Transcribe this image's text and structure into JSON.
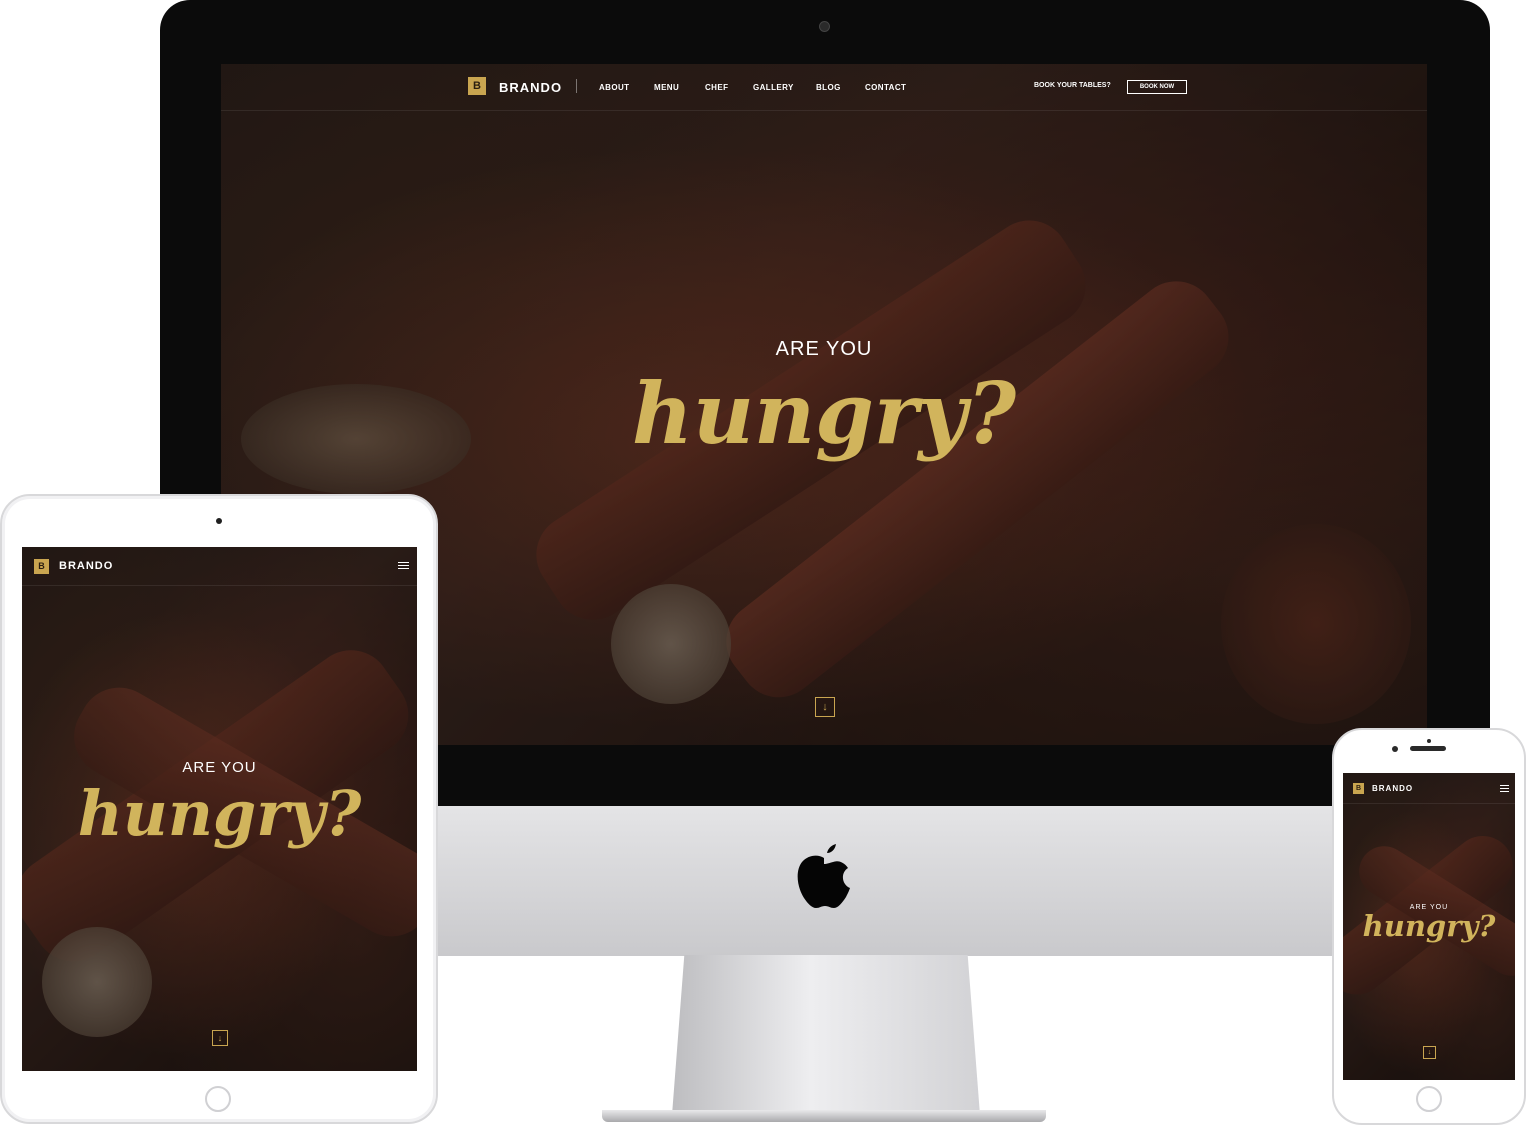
{
  "brand": {
    "logo_letter": "B",
    "name": "BRANDO"
  },
  "nav": {
    "items": [
      "ABOUT",
      "MENU",
      "CHEF",
      "GALLERY",
      "BLOG",
      "CONTACT"
    ],
    "book_prompt": "BOOK YOUR TABLES?",
    "book_button": "BOOK NOW"
  },
  "hero": {
    "line1": "ARE YOU",
    "line2": "hungry?",
    "down_arrow": "↓"
  },
  "colors": {
    "accent": "#c9a550",
    "script": "#d1b45c",
    "background": "#2a1d17"
  },
  "icons": {
    "menu": "hamburger-icon",
    "scroll": "arrow-down-icon",
    "device_logo": "apple-logo-icon"
  }
}
